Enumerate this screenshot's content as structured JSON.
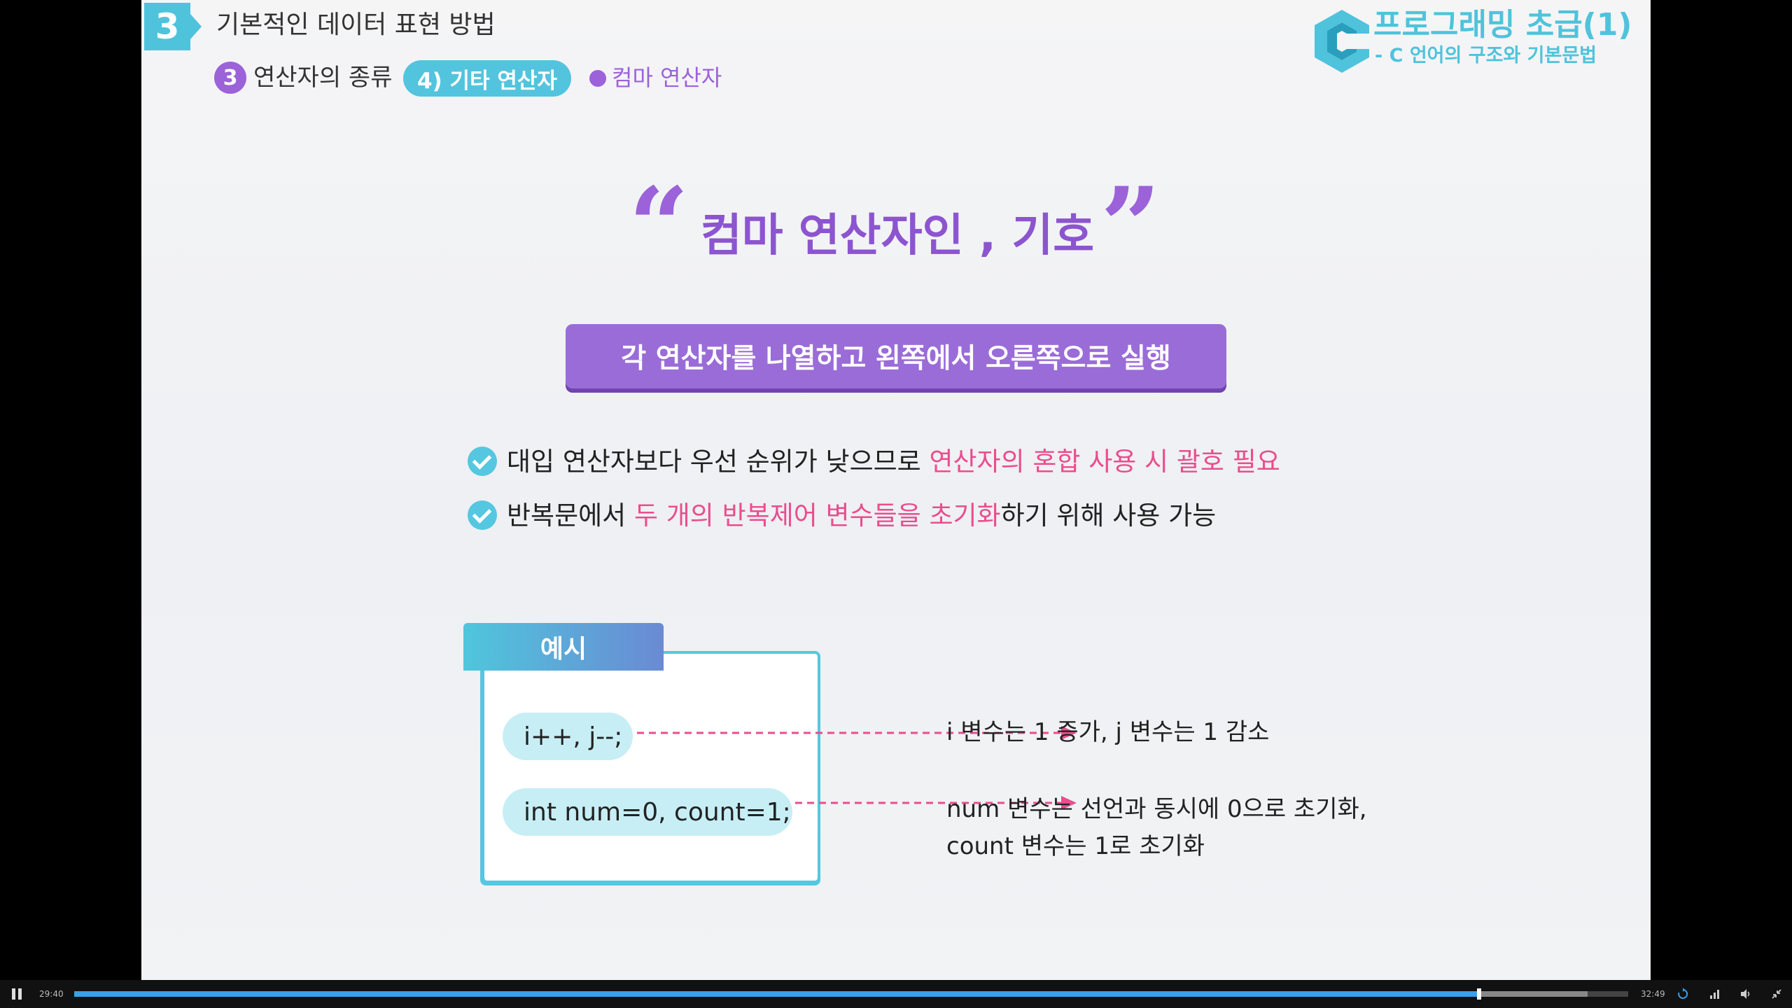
{
  "header": {
    "section_number": "3",
    "section_title": "기본적인 데이터 표현 방법",
    "breadcrumb_number": "3",
    "breadcrumb_types": "연산자의 종류",
    "breadcrumb_category": "4) 기타 연산자",
    "breadcrumb_topic": "컴마 연산자",
    "course_title": "프로그래밍 초급(1)",
    "course_subtitle": "- C 언어의 구조와 기본문법"
  },
  "title": {
    "open_quote": "“",
    "text": "컴마 연산자인 , 기호",
    "close_quote": "”"
  },
  "banner": "각 연산자를 나열하고 왼쪽에서 오른쪽으로 실행",
  "bullets": [
    {
      "pre": "대입 연산자보다 우선 순위가 낮으므로 ",
      "highlight": "연산자의 혼합 사용 시 괄호 필요",
      "post": ""
    },
    {
      "pre": "반복문에서 ",
      "highlight": "두 개의 반복제어 변수들을 초기화",
      "post": "하기 위해 사용 가능"
    }
  ],
  "example": {
    "label": "예시",
    "items": [
      {
        "code": "i++, j--;",
        "desc_line1": "i 변수는 1 증가, j 변수는 1 감소"
      },
      {
        "code": "int num=0, count=1;",
        "desc_line1": "num 변수는 선언과 동시에 0으로 초기화,",
        "desc_line2": "count 변수는 1로 초기화"
      }
    ]
  },
  "player": {
    "current_time": "29:40",
    "duration": "32:49",
    "progress": 0.904,
    "buffered": 0.974
  },
  "colors": {
    "accent_cyan": "#4fc3dc",
    "accent_purple": "#9b62d9",
    "highlight_pink": "#ea4d8e",
    "progress_blue": "#3aa0e8"
  },
  "icons": {
    "logo": "c-logo-icon",
    "check": "check-circle-icon",
    "play_pause": "pause-icon",
    "replay": "replay-icon",
    "quality": "signal-icon",
    "volume": "volume-icon",
    "fullscreen": "fullscreen-exit-icon"
  }
}
